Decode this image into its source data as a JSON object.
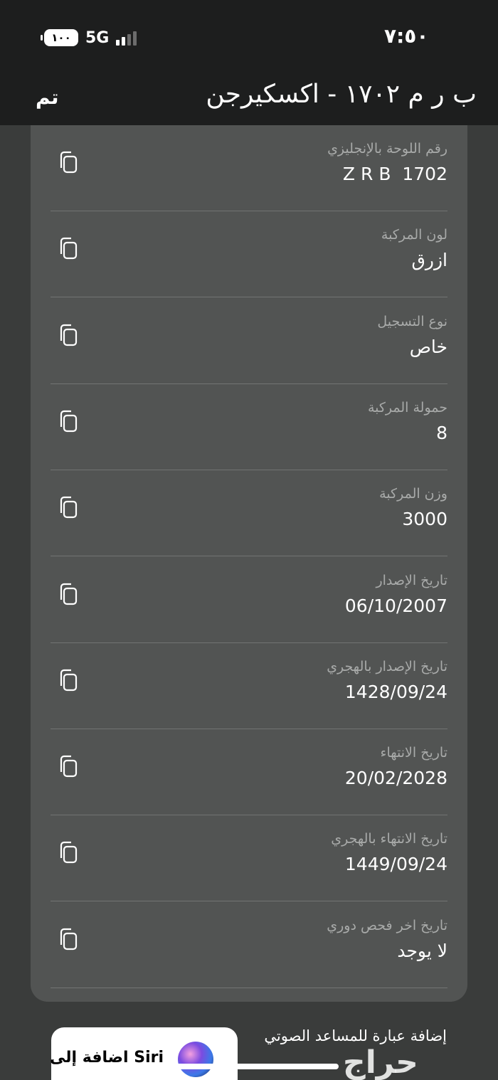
{
  "status_bar": {
    "battery": "١٠٠",
    "network": "5G",
    "time": "٧:٥٠"
  },
  "nav": {
    "done_label": "تم",
    "title": "ب ر م ١٧٠٢ - اكسكيرجن"
  },
  "fields": [
    {
      "label": "رقم اللوحة بالإنجليزي",
      "value": "1702  Z R B"
    },
    {
      "label": "لون المركبة",
      "value": "ازرق"
    },
    {
      "label": "نوع التسجيل",
      "value": "خاص"
    },
    {
      "label": "حمولة المركبة",
      "value": "8"
    },
    {
      "label": "وزن المركبة",
      "value": "3000"
    },
    {
      "label": "تاريخ الإصدار",
      "value": "06/10/2007"
    },
    {
      "label": "تاريخ الإصدار بالهجري",
      "value": "1428/09/24"
    },
    {
      "label": "تاريخ الانتهاء",
      "value": "20/02/2028"
    },
    {
      "label": "تاريخ الانتهاء بالهجري",
      "value": "1449/09/24"
    },
    {
      "label": "تاريخ اخر فحص دوري",
      "value": "لا يوجد"
    }
  ],
  "siri": {
    "caption": "إضافة عبارة للمساعد الصوتي",
    "button_label": "اضافة إلى Siri"
  },
  "watermark": "حراج",
  "icons": {
    "copy": "copy-icon",
    "siri": "siri-icon",
    "battery": "battery-icon",
    "signal": "signal-icon"
  },
  "colors": {
    "header_bg": "#1d1e1e",
    "page_bg": "#3a3c3b",
    "card_bg": "#525453",
    "label": "#a8aaa9"
  }
}
